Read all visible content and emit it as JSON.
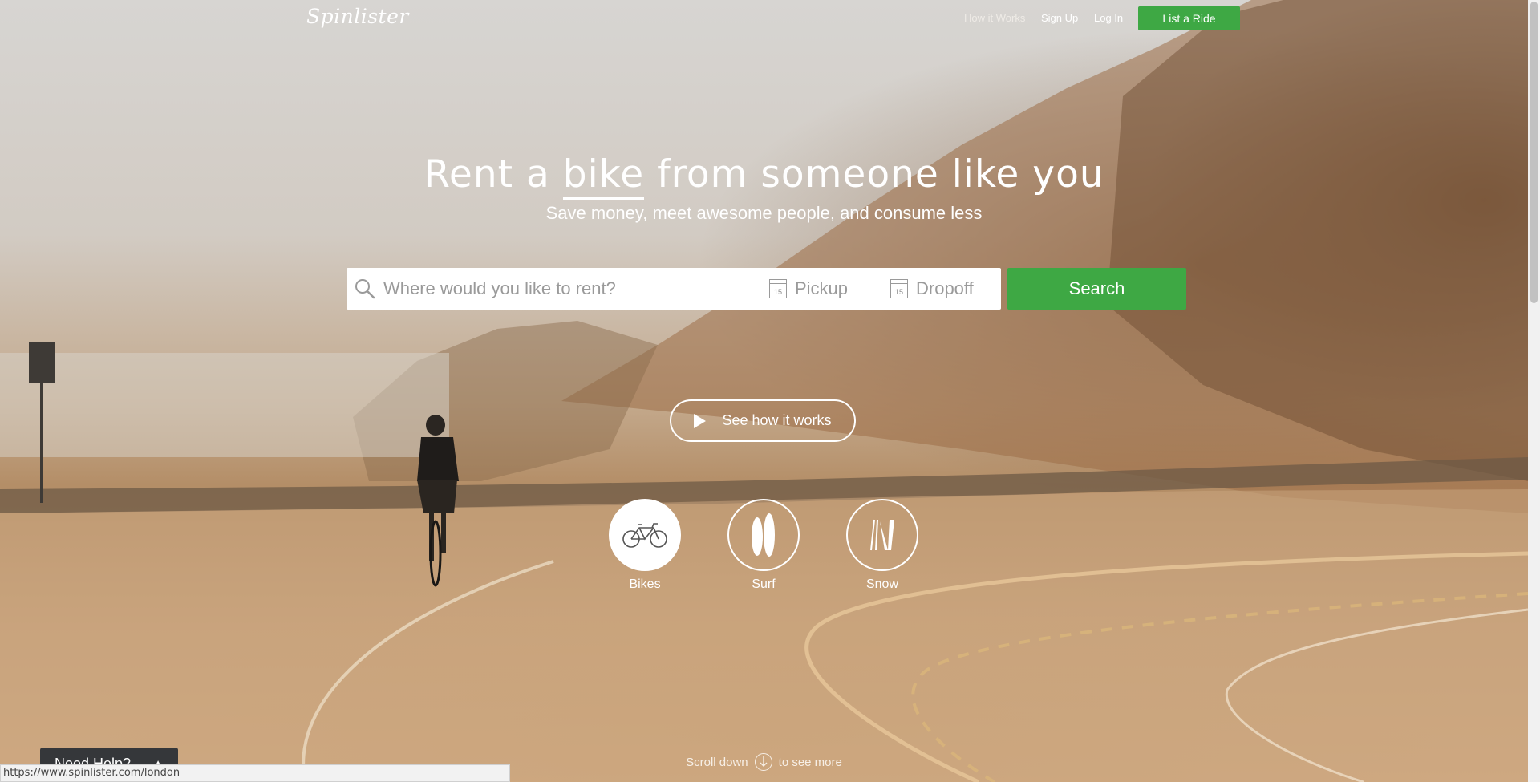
{
  "header": {
    "logo": "Spinlister",
    "nav": [
      "How it Works",
      "Sign Up",
      "Log In"
    ],
    "cta": "List a Ride"
  },
  "hero": {
    "title_before": "Rent a",
    "title_keyword": "bike",
    "title_after": "from someone like you",
    "subtitle": "Save money, meet awesome people, and consume less"
  },
  "search": {
    "location_placeholder": "Where would you like to rent?",
    "pickup_placeholder": "Pickup",
    "dropoff_placeholder": "Dropoff",
    "calendar_day": "15",
    "button": "Search"
  },
  "how_button": "See how it works",
  "categories": [
    {
      "label": "Bikes",
      "icon": "bicycle-icon",
      "active": true
    },
    {
      "label": "Surf",
      "icon": "surfboard-icon",
      "active": false
    },
    {
      "label": "Snow",
      "icon": "skis-icon",
      "active": false
    }
  ],
  "scroll_hint": {
    "before": "Scroll down",
    "after": "to see more"
  },
  "help_tab": "Need Help?",
  "status_url": "https://www.spinlister.com/london",
  "colors": {
    "accent_green": "#3ea844",
    "help_bg": "#35373a"
  }
}
